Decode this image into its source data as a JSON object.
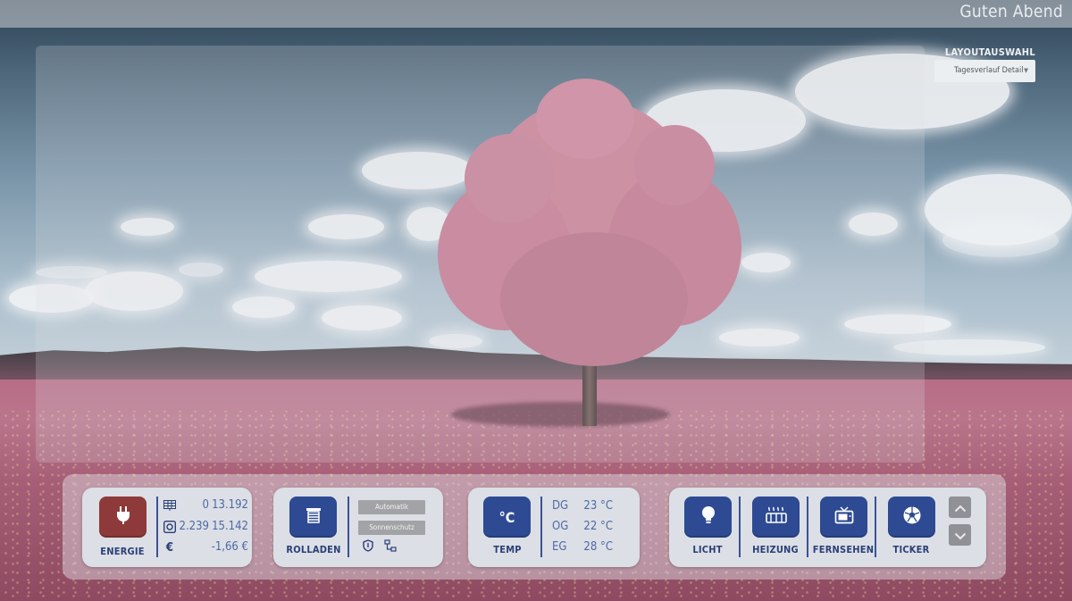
{
  "header": {
    "greeting": "Guten Abend"
  },
  "layout": {
    "title": "LAYOUTAUSWAHL",
    "selected": "Tagesverlauf Detail"
  },
  "energy": {
    "label": "ENERGIE",
    "icon": "power-plug-icon",
    "rows": [
      {
        "icon": "solar-panel-icon",
        "current": "0",
        "total": "13.192"
      },
      {
        "icon": "meter-icon",
        "current": "2.239",
        "total": "15.142"
      },
      {
        "icon": "euro-icon",
        "current": "",
        "total": "-1,66 €"
      }
    ]
  },
  "shutters": {
    "label": "ROLLADEN",
    "icon": "shutter-icon",
    "buttons": [
      "Automatik",
      "Sonnenschutz"
    ],
    "status_icons": [
      "shield-icon",
      "network-icon"
    ]
  },
  "temperature": {
    "label": "TEMP",
    "icon_text": "°C",
    "rows": [
      {
        "floor": "DG",
        "value": "23 °C"
      },
      {
        "floor": "OG",
        "value": "22 °C"
      },
      {
        "floor": "EG",
        "value": "28 °C"
      }
    ]
  },
  "devices": [
    {
      "label": "LICHT",
      "icon": "lightbulb-icon"
    },
    {
      "label": "HEIZUNG",
      "icon": "radiator-icon"
    },
    {
      "label": "FERNSEHEN",
      "icon": "tv-icon"
    },
    {
      "label": "TICKER",
      "icon": "football-icon"
    }
  ],
  "navigation": {
    "up_icon": "chevron-up-icon",
    "down_icon": "chevron-down-icon"
  },
  "colors": {
    "accent": "#2d4a93",
    "energy": "#8e3a3a",
    "text": "#2a3f78",
    "value": "#4e6aa6"
  }
}
